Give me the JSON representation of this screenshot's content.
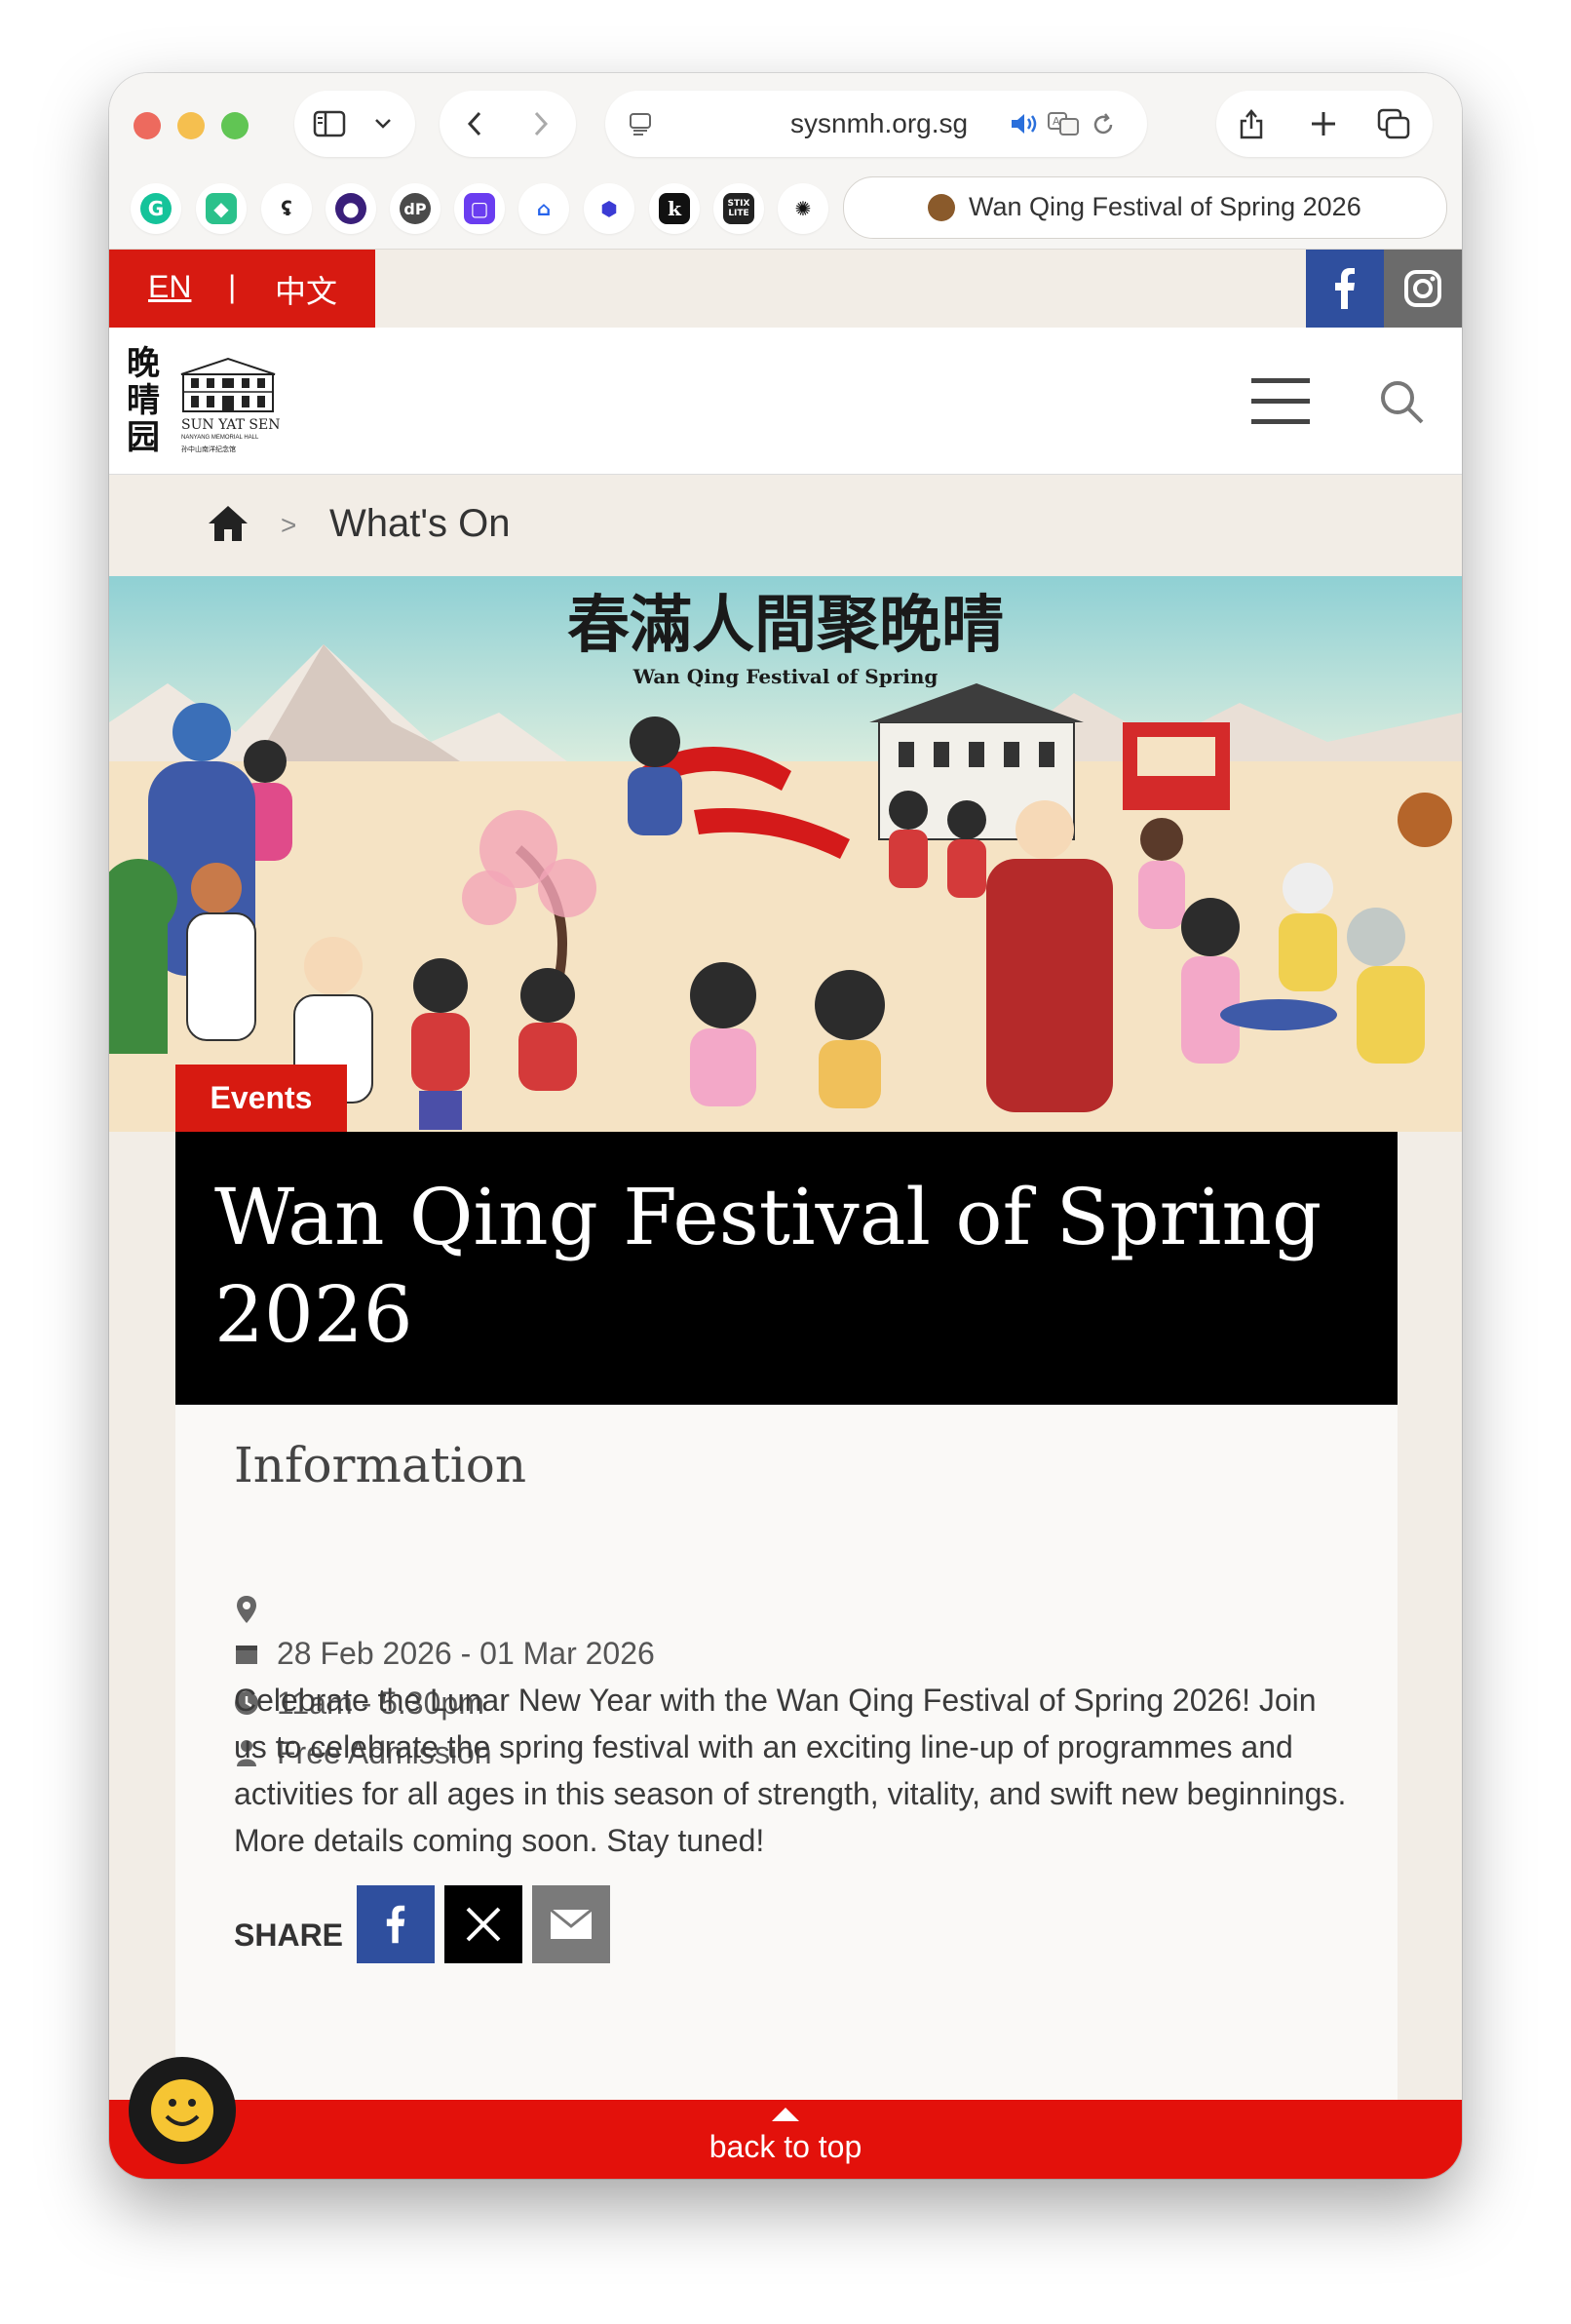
{
  "browser": {
    "url": "sysnmh.org.sg",
    "tab_title": "Wan Qing Festival of Spring 2026",
    "extensions": [
      "grammarly-icon",
      "cube-icon",
      "translate-icon",
      "sphere-icon",
      "dp-icon",
      "chat-square-icon",
      "ticket-icon",
      "shield-icon",
      "k-icon",
      "stix-icon",
      "openai-icon"
    ],
    "stix_label": "STIX LITE",
    "dp_label": "dP",
    "k_label": "k"
  },
  "topbar": {
    "lang_en": "EN",
    "lang_separator": "|",
    "lang_zh": "中文"
  },
  "logo": {
    "chinese": "晚晴园",
    "name": "SUN YAT SEN",
    "subtitle": "NANYANG MEMORIAL HALL",
    "subtitle_cn": "孙中山南洋纪念馆"
  },
  "breadcrumb": {
    "separator": ">",
    "current": "What's On"
  },
  "hero": {
    "chinese_title": "春滿人間聚晚晴",
    "english_title": "Wan Qing Festival of Spring"
  },
  "event": {
    "category": "Events",
    "title": "Wan Qing Festival of Spring 2026",
    "info_heading": "Information",
    "location": "",
    "date": "28 Feb 2026 - 01 Mar 2026",
    "time": "11am - 5.30pm",
    "admission": "Free Admission",
    "description": "Celebrate the Lunar New Year with the Wan Qing Festival of Spring 2026! Join us to celebrate the spring festival with an exciting line-up of programmes and activities for all ages in this season of strength, vitality, and swift new beginnings. More details coming soon. Stay tuned!"
  },
  "share": {
    "label": "SHARE"
  },
  "footer": {
    "back_to_top": "back to top"
  },
  "colors": {
    "brand_red": "#d71a11",
    "facebook_blue": "#2f4f9e",
    "background": "#f2ede6"
  }
}
